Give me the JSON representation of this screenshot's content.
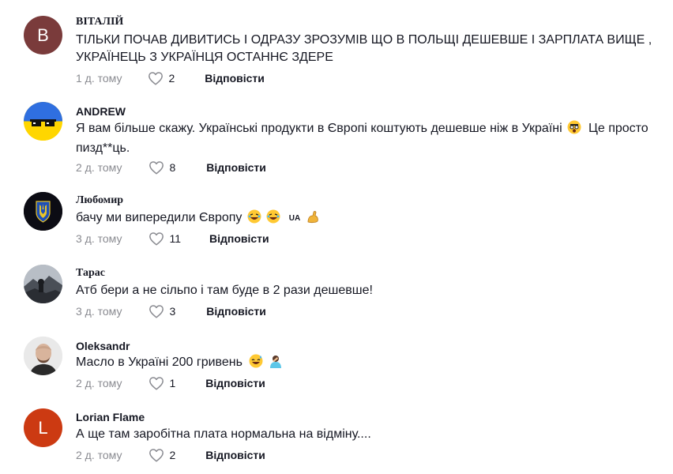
{
  "comments": [
    {
      "username": "ВІТАЛІЙ",
      "avatar_letter": "В",
      "avatar_color": "#7a3b3b",
      "text": "ТІЛЬКИ ПОЧАВ ДИВИТИСЬ І ОДРАЗУ ЗРОЗУМІВ ЩО В ПОЛЬЩІ ДЕШЕВШЕ І ЗАРПЛАТА ВИЩЕ , УКРАЇНЕЦЬ З УКРАЇНЦЯ ОСТАННЄ ЗДЕРЕ",
      "time": "1 д. тому",
      "likes": "2",
      "reply_label": "Відповісти"
    },
    {
      "username": "ANDREW",
      "avatar_icon": "sunglasses-flag-icon",
      "text": "Я вам більше скажу. Українські продукти в Європі коштують дешевше ніж в Україні",
      "text_after_emoji": " Це просто пизд**ць.",
      "emoji": "shocked-face-icon",
      "time": "2 д. тому",
      "likes": "8",
      "reply_label": "Відповісти"
    },
    {
      "username": "Любомир",
      "avatar_icon": "trident-emblem-icon",
      "text": "бачу ми випередили Європу",
      "emoji": [
        "laughing-face-icon",
        "laughing-face-icon",
        "ua-flex-icon"
      ],
      "emoji_text": "UA",
      "time": "3 д. тому",
      "likes": "11",
      "reply_label": "Відповісти"
    },
    {
      "username": "Тарас",
      "avatar_icon": "landscape-photo-icon",
      "text": "Атб бери а не сільпо і там буде в 2 рази дешевше!",
      "time": "3 д. тому",
      "likes": "3",
      "reply_label": "Відповісти"
    },
    {
      "username": "Oleksandr",
      "avatar_icon": "portrait-photo-icon",
      "text": "Масло в Україні 200 гривень",
      "emoji": [
        "sweat-smile-icon",
        "facepalm-icon"
      ],
      "time": "2 д. тому",
      "likes": "1",
      "reply_label": "Відповісти"
    },
    {
      "username": "Lorian Flame",
      "avatar_letter": "L",
      "avatar_color": "#cc3a12",
      "text": "А ще там заробітна плата нормальна на відміну....",
      "time": "2 д. тому",
      "likes": "2",
      "reply_label": "Відповісти"
    }
  ],
  "colors": {
    "text": "#161823",
    "muted": "#8a8b91",
    "background": "#ffffff"
  }
}
